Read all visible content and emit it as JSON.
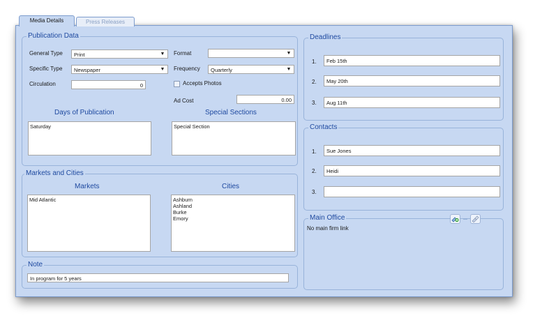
{
  "tabs": [
    {
      "label": "Media Details"
    },
    {
      "label": "Press Releases"
    }
  ],
  "publication": {
    "legend": "Publication Data",
    "general_type_label": "General Type",
    "general_type_value": "Print",
    "specific_type_label": "Specific Type",
    "specific_type_value": "Newspaper",
    "circulation_label": "Circulation",
    "circulation_value": "0",
    "format_label": "Format",
    "format_value": "",
    "frequency_label": "Frequency",
    "frequency_value": "Quarterly",
    "accepts_photos_label": "Accepts Photos",
    "ad_cost_label": "Ad Cost",
    "ad_cost_value": "0.00",
    "days_heading": "Days of Publication",
    "days_items": [
      "Saturday"
    ],
    "special_heading": "Special Sections",
    "special_items": [
      "Special Section"
    ]
  },
  "markets": {
    "legend": "Markets and Cities",
    "markets_heading": "Markets",
    "markets_items": [
      "Mid Atlantic"
    ],
    "cities_heading": "Cities",
    "cities_items": [
      "Ashburn",
      "Ashland",
      "Burke",
      "Emory"
    ]
  },
  "note": {
    "legend": "Note",
    "value": "In program for 5 years"
  },
  "deadlines": {
    "legend": "Deadlines",
    "items": [
      {
        "num": "1.",
        "value": "Feb 15th"
      },
      {
        "num": "2.",
        "value": "May 20th"
      },
      {
        "num": "3.",
        "value": "Aug 11th"
      }
    ]
  },
  "contacts": {
    "legend": "Contacts",
    "items": [
      {
        "num": "1.",
        "value": "Sue Jones"
      },
      {
        "num": "2.",
        "value": "Heidi"
      },
      {
        "num": "3.",
        "value": ""
      }
    ]
  },
  "main_office": {
    "legend": "Main Office",
    "text": "No main firm link"
  },
  "icons": {
    "dropdown_arrow": "▼",
    "add_link": "add-link-icon",
    "remove_link": "remove-link-icon"
  }
}
